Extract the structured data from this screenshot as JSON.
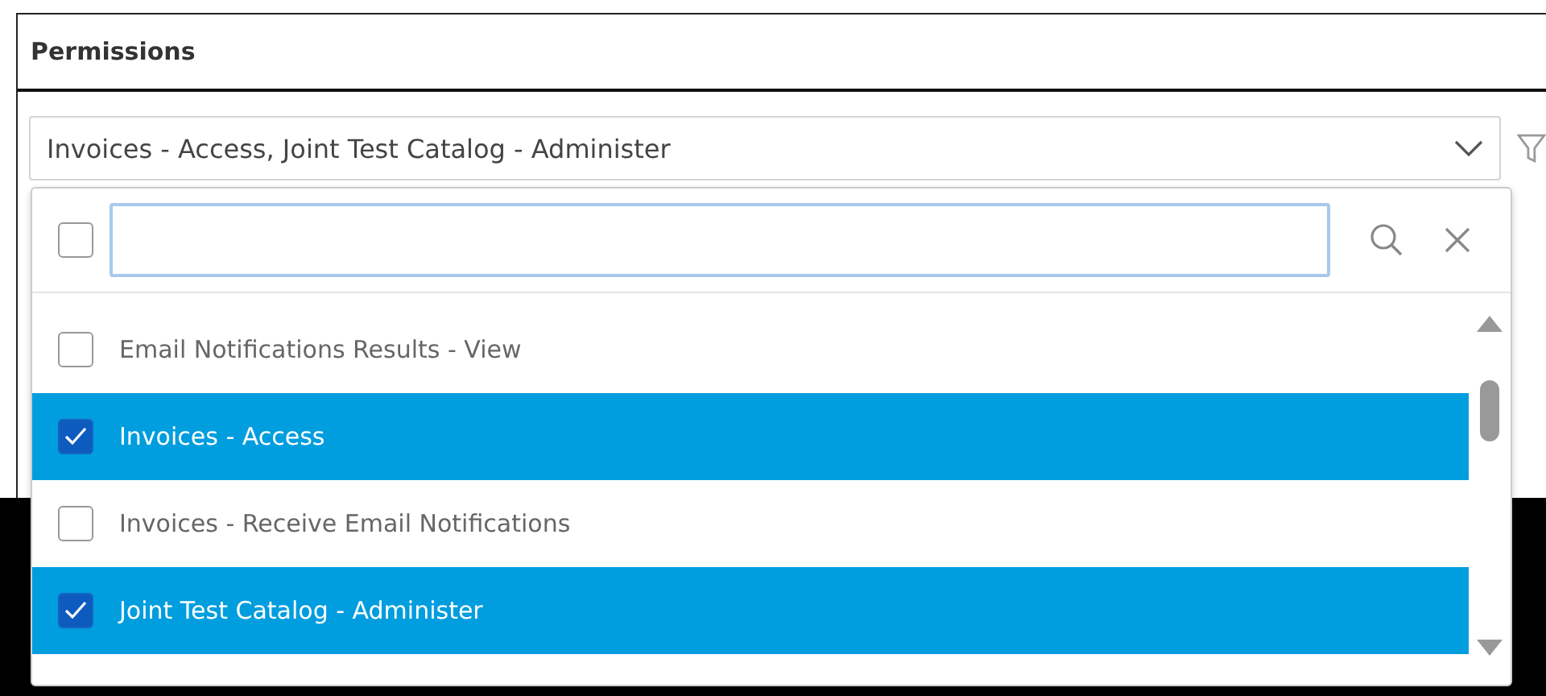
{
  "panel": {
    "title": "Permissions"
  },
  "select": {
    "value": "Invoices - Access, Joint Test Catalog - Administer",
    "expanded": true
  },
  "dropdown": {
    "select_all": {
      "checked": false
    },
    "search": {
      "focused": true
    },
    "options": [
      {
        "label": "Email Notifications Results - View",
        "selected": false
      },
      {
        "label": "Invoices - Access",
        "selected": true
      },
      {
        "label": "Invoices - Receive Email Notifications",
        "selected": false
      },
      {
        "label": "Joint Test Catalog - Administer",
        "selected": true
      }
    ]
  }
}
